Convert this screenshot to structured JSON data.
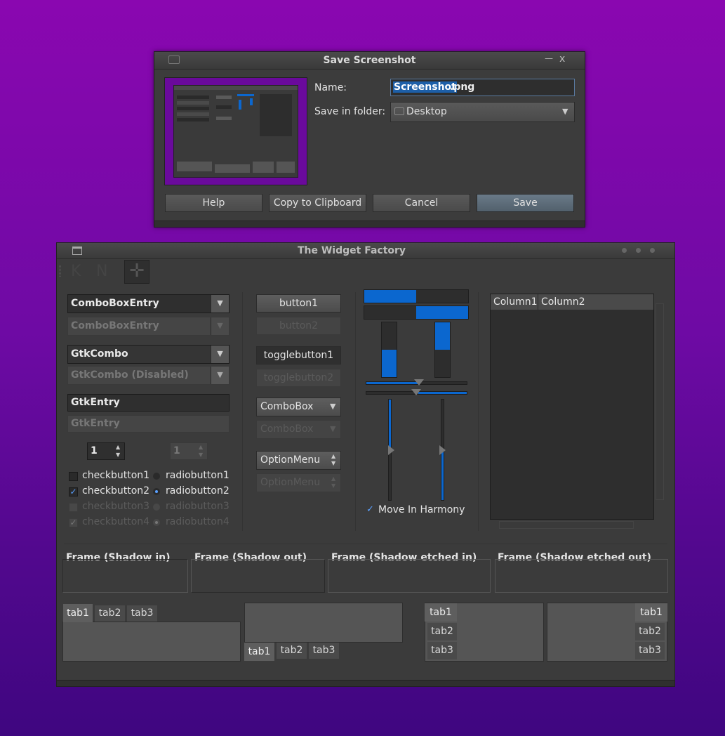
{
  "dialog": {
    "title": "Save Screenshot",
    "name_label": "Name:",
    "name_selected": "Screenshot",
    "name_rest": ".png",
    "folder_label": "Save in folder:",
    "folder_value": "Desktop",
    "buttons": {
      "help": "Help",
      "copy": "Copy to Clipboard",
      "cancel": "Cancel",
      "save": "Save"
    },
    "minimize_glyph": "—",
    "close_glyph": "x"
  },
  "factory": {
    "title": "The Widget Factory",
    "combos": {
      "comboboxentry": "ComboBoxEntry",
      "comboboxentry_disabled": "ComboBoxEntry",
      "gtkcombo": "GtkCombo",
      "gtkcombo_disabled": "GtkCombo (Disabled)",
      "gtkentry": "GtkEntry",
      "gtkentry_disabled": "GtkEntry"
    },
    "spin": {
      "value": "1",
      "disabled_value": "1"
    },
    "checks": [
      "checkbutton1",
      "checkbutton2",
      "checkbutton3",
      "checkbutton4"
    ],
    "radios": [
      "radiobutton1",
      "radiobutton2",
      "radiobutton3",
      "radiobutton4"
    ],
    "buttons": {
      "button1": "button1",
      "button2": "button2",
      "toggle1": "togglebutton1",
      "toggle2": "togglebutton2",
      "combobox": "ComboBox",
      "combobox_disabled": "ComboBox",
      "optionmenu": "OptionMenu",
      "optionmenu_disabled": "OptionMenu"
    },
    "progress": {
      "h1": 0.5,
      "h2": 0.5,
      "v1": 0.5,
      "v2": 0.5
    },
    "harmony_label": "Move In Harmony",
    "tree_columns": [
      "Column1",
      "Column2"
    ],
    "frames": [
      "Frame (Shadow in)",
      "Frame (Shadow out)",
      "Frame (Shadow etched in)",
      "Frame (Shadow etched out)"
    ],
    "tabs": [
      "tab1",
      "tab2",
      "tab3"
    ]
  }
}
